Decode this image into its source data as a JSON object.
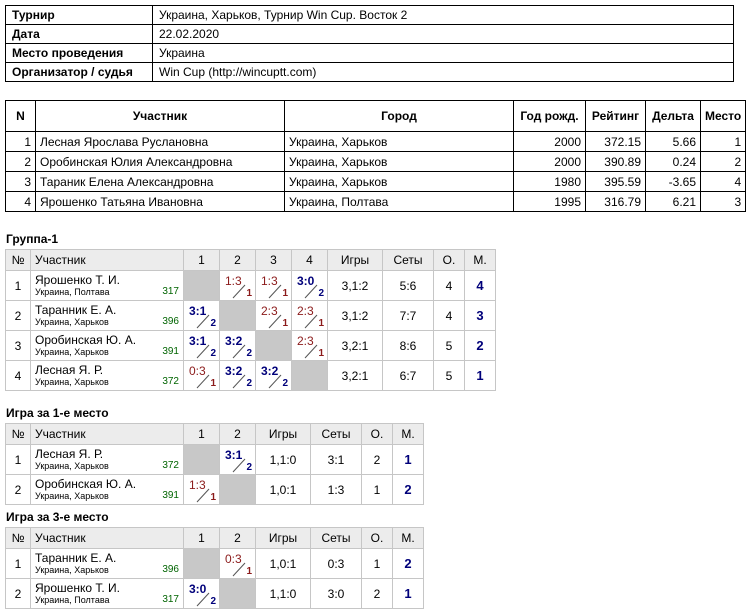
{
  "info": [
    {
      "label": "Турнир",
      "value": "Украина, Харьков, Турнир Win Cup. Восток 2"
    },
    {
      "label": "Дата",
      "value": "22.02.2020"
    },
    {
      "label": "Место проведения",
      "value": "Украина"
    },
    {
      "label": "Организатор / судья",
      "value": "Win Cup (http://wincuptt.com)"
    }
  ],
  "participants": {
    "headers": [
      "N",
      "Участник",
      "Город",
      "Год рожд.",
      "Рейтинг",
      "Дельта",
      "Место"
    ],
    "rows": [
      [
        "1",
        "Лесная Ярослава Руслановна",
        "Украина, Харьков",
        "2000",
        "372.15",
        "5.66",
        "1"
      ],
      [
        "2",
        "Оробинская Юлия Александровна",
        "Украина, Харьков",
        "2000",
        "390.89",
        "0.24",
        "2"
      ],
      [
        "3",
        "Тараник Елена Александровна",
        "Украина, Харьков",
        "1980",
        "395.59",
        "-3.65",
        "4"
      ],
      [
        "4",
        "Ярошенко Татьяна Ивановна",
        "Украина, Полтава",
        "1995",
        "316.79",
        "6.21",
        "3"
      ]
    ]
  },
  "groups": [
    {
      "title": "Группа-1",
      "headers": [
        "№",
        "Участник",
        "1",
        "2",
        "3",
        "4",
        "Игры",
        "Сеты",
        "О.",
        "М."
      ],
      "rows": [
        {
          "num": "1",
          "name": "Ярошенко Т. И.",
          "city": "Украина, Полтава",
          "rating": "317",
          "cells": [
            {
              "diag": true
            },
            {
              "score": "1:3",
              "pts": "1",
              "win": false
            },
            {
              "score": "1:3",
              "pts": "1",
              "win": false
            },
            {
              "score": "3:0",
              "pts": "2",
              "win": true
            }
          ],
          "games": "3,1:2",
          "sets": "5:6",
          "points": "4",
          "place": "4"
        },
        {
          "num": "2",
          "name": "Таранник Е. А.",
          "city": "Украина, Харьков",
          "rating": "396",
          "cells": [
            {
              "score": "3:1",
              "pts": "2",
              "win": true
            },
            {
              "diag": true
            },
            {
              "score": "2:3",
              "pts": "1",
              "win": false
            },
            {
              "score": "2:3",
              "pts": "1",
              "win": false
            }
          ],
          "games": "3,1:2",
          "sets": "7:7",
          "points": "4",
          "place": "3"
        },
        {
          "num": "3",
          "name": "Оробинская Ю. А.",
          "city": "Украина, Харьков",
          "rating": "391",
          "cells": [
            {
              "score": "3:1",
              "pts": "2",
              "win": true
            },
            {
              "score": "3:2",
              "pts": "2",
              "win": true
            },
            {
              "diag": true
            },
            {
              "score": "2:3",
              "pts": "1",
              "win": false
            }
          ],
          "games": "3,2:1",
          "sets": "8:6",
          "points": "5",
          "place": "2"
        },
        {
          "num": "4",
          "name": "Лесная Я. Р.",
          "city": "Украина, Харьков",
          "rating": "372",
          "cells": [
            {
              "score": "0:3",
              "pts": "1",
              "win": false
            },
            {
              "score": "3:2",
              "pts": "2",
              "win": true
            },
            {
              "score": "3:2",
              "pts": "2",
              "win": true
            },
            {
              "diag": true
            }
          ],
          "games": "3,2:1",
          "sets": "6:7",
          "points": "5",
          "place": "1"
        }
      ]
    },
    {
      "title": "Игра за 1-е место",
      "headers": [
        "№",
        "Участник",
        "1",
        "2",
        "Игры",
        "Сеты",
        "О.",
        "М."
      ],
      "rows": [
        {
          "num": "1",
          "name": "Лесная Я. Р.",
          "city": "Украина, Харьков",
          "rating": "372",
          "cells": [
            {
              "diag": true
            },
            {
              "score": "3:1",
              "pts": "2",
              "win": true
            }
          ],
          "games": "1,1:0",
          "sets": "3:1",
          "points": "2",
          "place": "1"
        },
        {
          "num": "2",
          "name": "Оробинская Ю. А.",
          "city": "Украина, Харьков",
          "rating": "391",
          "cells": [
            {
              "score": "1:3",
              "pts": "1",
              "win": false
            },
            {
              "diag": true
            }
          ],
          "games": "1,0:1",
          "sets": "1:3",
          "points": "1",
          "place": "2"
        }
      ]
    },
    {
      "title": "Игра за 3-е место",
      "headers": [
        "№",
        "Участник",
        "1",
        "2",
        "Игры",
        "Сеты",
        "О.",
        "М."
      ],
      "rows": [
        {
          "num": "1",
          "name": "Таранник Е. А.",
          "city": "Украина, Харьков",
          "rating": "396",
          "cells": [
            {
              "diag": true
            },
            {
              "score": "0:3",
              "pts": "1",
              "win": false
            }
          ],
          "games": "1,0:1",
          "sets": "0:3",
          "points": "1",
          "place": "2"
        },
        {
          "num": "2",
          "name": "Ярошенко Т. И.",
          "city": "Украина, Полтава",
          "rating": "317",
          "cells": [
            {
              "score": "3:0",
              "pts": "2",
              "win": true
            },
            {
              "diag": true
            }
          ],
          "games": "1,1:0",
          "sets": "3:0",
          "points": "2",
          "place": "1"
        }
      ]
    }
  ]
}
